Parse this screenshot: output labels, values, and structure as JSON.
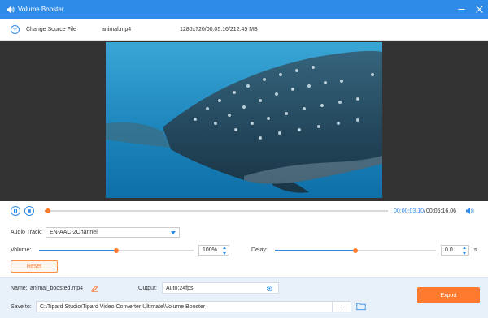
{
  "window": {
    "title": "Volume Booster",
    "icons": {
      "app": "speaker-icon",
      "minimize": "minimize-icon",
      "close": "close-icon"
    }
  },
  "toolbar": {
    "change_source_label": "Change Source File",
    "file_name": "animal.mp4",
    "file_info": "1280x720/00:05:16/212.45 MB"
  },
  "player": {
    "current_time": "00:00:03.10",
    "separator": "/",
    "total_time": "00:05:16.06",
    "progress_fraction": 0.01,
    "icons": {
      "pause": "pause-icon",
      "stop": "stop-icon",
      "volume": "volume-icon"
    }
  },
  "settings": {
    "audio_track_label": "Audio Track:",
    "audio_track_value": "EN-AAC-2Channel",
    "volume_label": "Volume:",
    "volume_value": "100%",
    "volume_fraction": 0.5,
    "delay_label": "Delay:",
    "delay_value": "0.0",
    "delay_unit": "s",
    "delay_fraction": 0.5,
    "reset_label": "Reset"
  },
  "output": {
    "name_label": "Name:",
    "name_value": "animal_boosted.mp4",
    "output_label": "Output:",
    "output_value": "Auto;24fps",
    "save_to_label": "Save to:",
    "save_path": "C:\\Tipard Studio\\Tipard Video Converter Ultimate\\Volume Booster",
    "browse_label": "···",
    "export_label": "Export"
  },
  "colors": {
    "accent": "#2e8be8",
    "orange": "#ff7a2e",
    "preview_bg": "#333333",
    "bottom_bg": "#e8f0f9"
  }
}
